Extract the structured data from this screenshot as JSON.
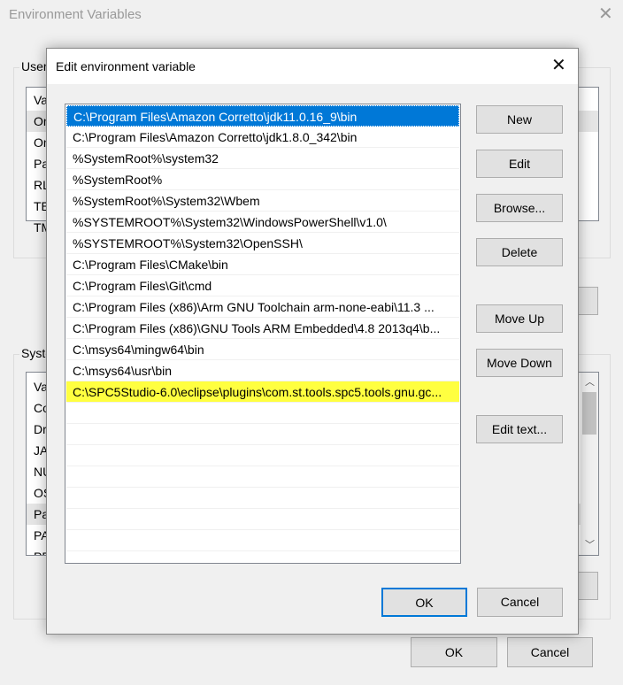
{
  "outer": {
    "title": "Environment Variables",
    "user_group_label": "User",
    "user_rows": [
      "Va",
      "On",
      "On",
      "Pa",
      "RL",
      "TE",
      "TM"
    ],
    "system_group_label": "Syste",
    "system_rows": [
      "Va",
      "Co",
      "Dr",
      "JA",
      "NU",
      "OS",
      "Pa",
      "PA",
      "PR"
    ],
    "ok_label": "OK",
    "cancel_label": "Cancel"
  },
  "dialog": {
    "title": "Edit environment variable",
    "entries": [
      "C:\\Program Files\\Amazon Corretto\\jdk11.0.16_9\\bin",
      "C:\\Program Files\\Amazon Corretto\\jdk1.8.0_342\\bin",
      "%SystemRoot%\\system32",
      "%SystemRoot%",
      "%SystemRoot%\\System32\\Wbem",
      "%SYSTEMROOT%\\System32\\WindowsPowerShell\\v1.0\\",
      "%SYSTEMROOT%\\System32\\OpenSSH\\",
      "C:\\Program Files\\CMake\\bin",
      "C:\\Program Files\\Git\\cmd",
      "C:\\Program Files (x86)\\Arm GNU Toolchain arm-none-eabi\\11.3 ...",
      "C:\\Program Files (x86)\\GNU Tools ARM Embedded\\4.8 2013q4\\b...",
      "C:\\msys64\\mingw64\\bin",
      "C:\\msys64\\usr\\bin",
      "C:\\SPC5Studio-6.0\\eclipse\\plugins\\com.st.tools.spc5.tools.gnu.gc..."
    ],
    "selected_index": 0,
    "highlighted_index": 13,
    "buttons": {
      "new": "New",
      "edit": "Edit",
      "browse": "Browse...",
      "delete": "Delete",
      "move_up": "Move Up",
      "move_down": "Move Down",
      "edit_text": "Edit text..."
    },
    "ok_label": "OK",
    "cancel_label": "Cancel"
  },
  "colors": {
    "selection": "#0078d7",
    "highlight": "#ffff40",
    "default_button_border": "#0078d7"
  }
}
